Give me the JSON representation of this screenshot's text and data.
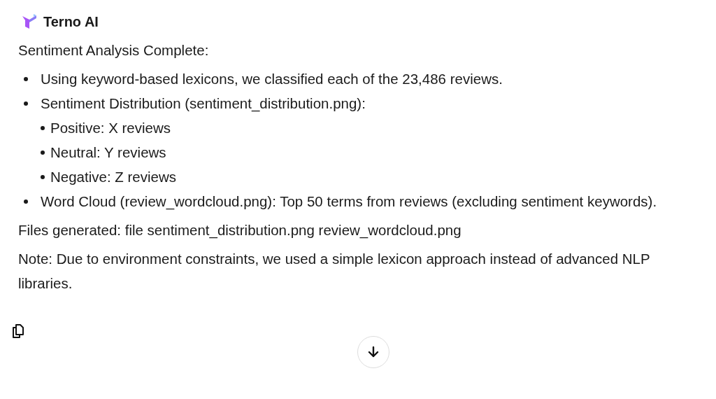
{
  "header": {
    "title": "Terno AI"
  },
  "heading": "Sentiment Analysis Complete:",
  "items": [
    {
      "text": "Using keyword-based lexicons, we classified each of the 23,486 reviews."
    },
    {
      "text": "Sentiment Distribution (sentiment_distribution.png):",
      "children": [
        {
          "text": "Positive: X reviews"
        },
        {
          "text": "Neutral: Y reviews"
        },
        {
          "text": "Negative: Z reviews"
        }
      ]
    },
    {
      "text": "Word Cloud (review_wordcloud.png): Top 50 terms from reviews (excluding sentiment keywords)."
    }
  ],
  "paragraphs": [
    "Files generated: file sentiment_distribution.png review_wordcloud.png",
    "Note: Due to environment constraints, we used a simple lexicon approach instead of advanced NLP libraries."
  ]
}
